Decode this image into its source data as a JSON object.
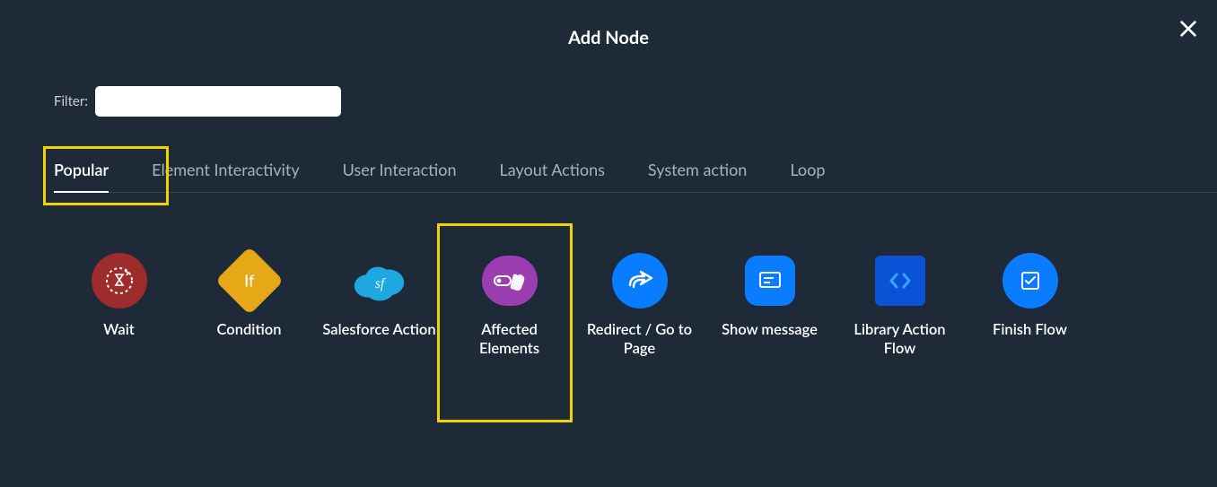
{
  "title": "Add Node",
  "close_aria": "Close",
  "filter": {
    "label": "Filter:",
    "value": "",
    "placeholder": ""
  },
  "tabs": [
    {
      "id": "popular",
      "label": "Popular",
      "active": true
    },
    {
      "id": "element-interactivity",
      "label": "Element Interactivity",
      "active": false
    },
    {
      "id": "user-interaction",
      "label": "User Interaction",
      "active": false
    },
    {
      "id": "layout-actions",
      "label": "Layout Actions",
      "active": false
    },
    {
      "id": "system-action",
      "label": "System action",
      "active": false
    },
    {
      "id": "loop",
      "label": "Loop",
      "active": false
    }
  ],
  "nodes": [
    {
      "id": "wait",
      "label": "Wait",
      "icon": "hourglass-icon",
      "color": "#9d2c2c"
    },
    {
      "id": "condition",
      "label": "Condition",
      "icon": "if-icon",
      "color": "#e6a817"
    },
    {
      "id": "salesforce-action",
      "label": "Salesforce Action",
      "icon": "salesforce-icon",
      "color": "#1ea7e0"
    },
    {
      "id": "affected-elements",
      "label": "Affected Elements",
      "icon": "hand-click-icon",
      "color": "#9b3fb0",
      "highlighted": true
    },
    {
      "id": "redirect",
      "label": "Redirect / Go to Page",
      "icon": "arrow-forward-icon",
      "color": "#0a7cff"
    },
    {
      "id": "show-message",
      "label": "Show message",
      "icon": "message-icon",
      "color": "#0a7cff"
    },
    {
      "id": "library-action-flow",
      "label": "Library Action Flow",
      "icon": "code-icon",
      "color": "#0a52d6"
    },
    {
      "id": "finish-flow",
      "label": "Finish Flow",
      "icon": "checkbox-icon",
      "color": "#0a7cff"
    }
  ],
  "highlights": {
    "tab_popular": true,
    "node_affected_elements": true
  }
}
